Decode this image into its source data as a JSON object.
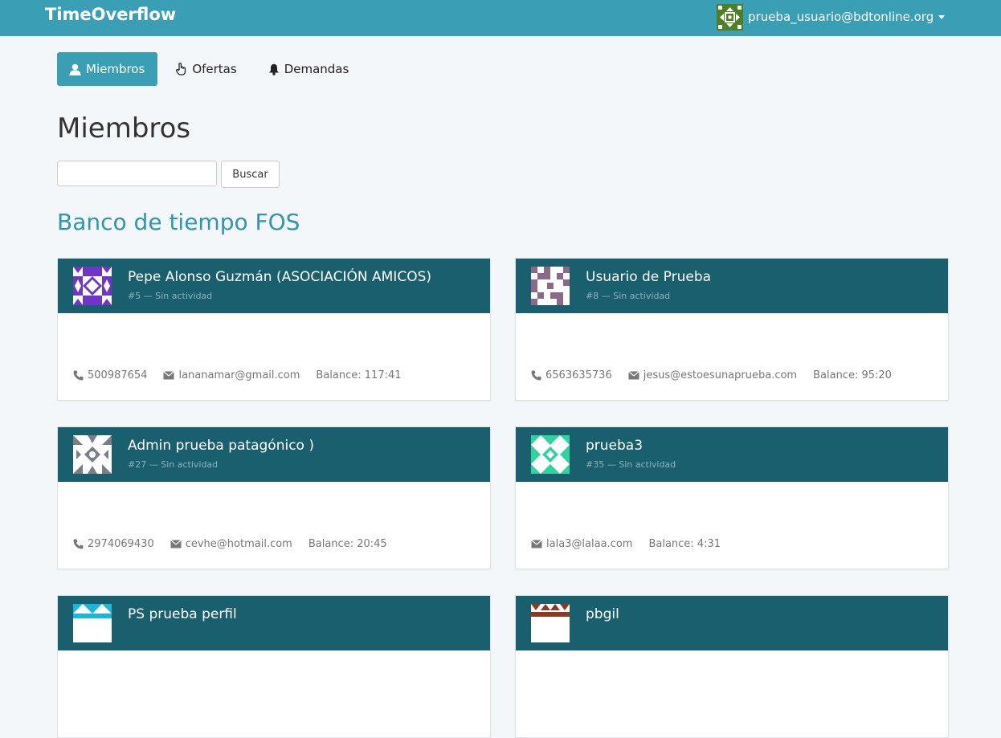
{
  "navbar": {
    "brand": "TimeOverflow",
    "user_email": "prueba_usuario@bdtonline.org"
  },
  "tabs": [
    {
      "label": "Miembros",
      "icon": "user-icon",
      "active": true
    },
    {
      "label": "Ofertas",
      "icon": "hand-pointer-icon",
      "active": false
    },
    {
      "label": "Demandas",
      "icon": "bell-icon",
      "active": false
    }
  ],
  "page": {
    "title": "Miembros",
    "search_value": "",
    "search_button": "Buscar",
    "org_name": "Banco de tiempo FOS"
  },
  "members": [
    {
      "name": "Pepe Alonso Guzmán (ASOCIACIÓN AMICOS)",
      "sub": "#5 — Sin actividad",
      "phone": "500987654",
      "email": "lananamar@gmail.com",
      "balance": "Balance: 117:41",
      "avatar_color": "#6f35c9"
    },
    {
      "name": "Usuario de Prueba",
      "sub": "#8 — Sin actividad",
      "phone": "6563635736",
      "email": "jesus@estoesunaprueba.com",
      "balance": "Balance: 95:20",
      "avatar_color": "#8a6a88"
    },
    {
      "name": "Admin prueba patagónico )",
      "sub": "#27 — Sin actividad",
      "phone": "2974069430",
      "email": "cevhe@hotmail.com",
      "balance": "Balance: 20:45",
      "avatar_color": "#7a7f87"
    },
    {
      "name": "prueba3",
      "sub": "#35 — Sin actividad",
      "phone": "",
      "email": "lala3@lalaa.com",
      "balance": "Balance: 4:31",
      "avatar_color": "#2fd3a0"
    },
    {
      "name": "PS prueba perfil",
      "sub": "",
      "phone": "",
      "email": "",
      "balance": "",
      "avatar_color": "#19b8d8"
    },
    {
      "name": "pbgil",
      "sub": "",
      "phone": "",
      "email": "",
      "balance": "",
      "avatar_color": "#8c3a22"
    }
  ],
  "colors": {
    "navbar": "#3a9fb5",
    "card_header": "#1a5f6e",
    "org_title": "#2f96ae"
  }
}
